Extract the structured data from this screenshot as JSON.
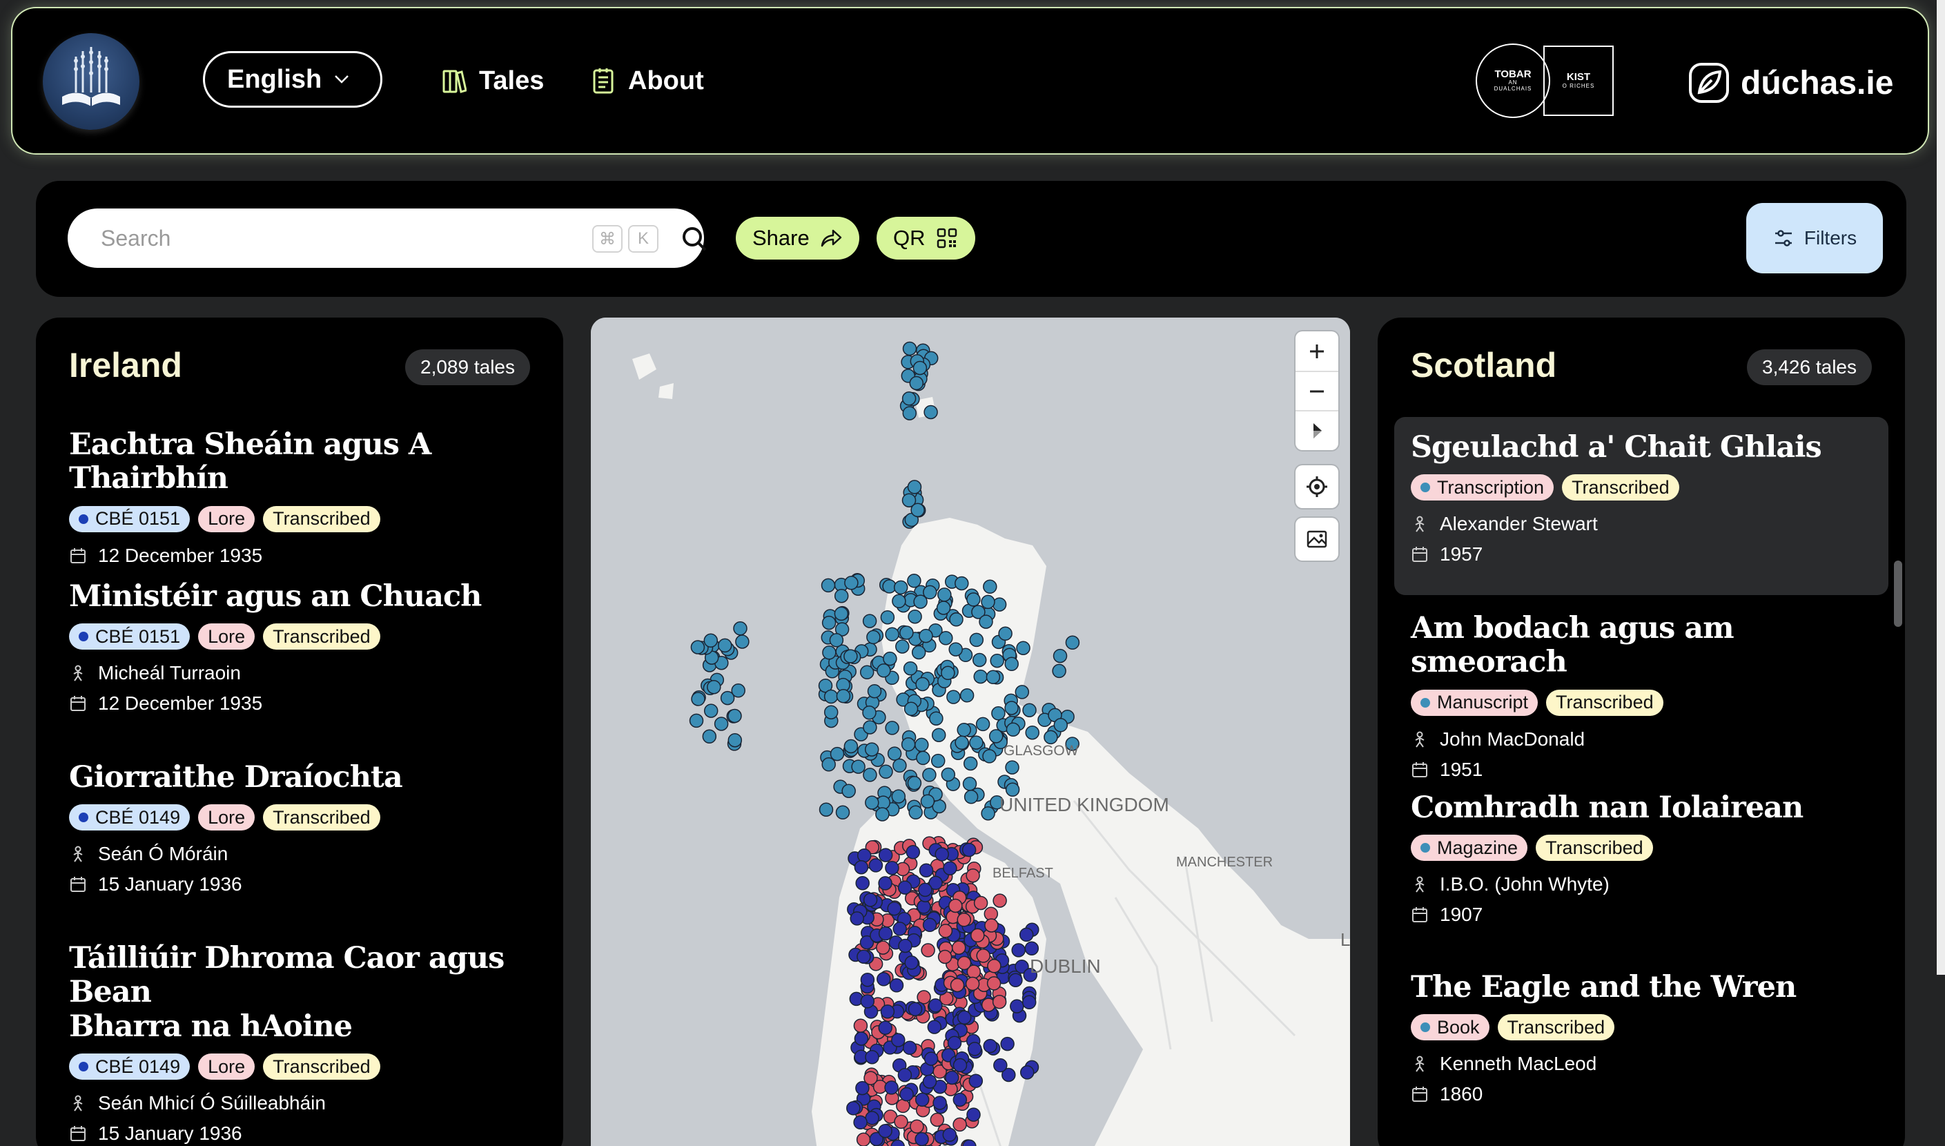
{
  "header": {
    "language": "English",
    "nav": {
      "tales": "Tales",
      "about": "About"
    },
    "partner1": {
      "line1": "TOBAR",
      "small": "AN",
      "line2": "DUALCHAIS"
    },
    "partner2": {
      "line1": "KIST",
      "line2": "O RICHES"
    },
    "site": "dúchas.ie"
  },
  "toolbar": {
    "search_placeholder": "Search",
    "kbd1": "⌘",
    "kbd2": "K",
    "share": "Share",
    "qr": "QR",
    "filters": "Filters"
  },
  "ireland": {
    "title": "Ireland",
    "count": "2,089 tales",
    "tales": [
      {
        "title": "Eachtra Sheáin agus A Thairbhín",
        "tags": [
          "CBÉ 0151",
          "Lore",
          "Transcribed"
        ],
        "date": "12 December 1935"
      },
      {
        "title": "Ministéir agus an Chuach",
        "tags": [
          "CBÉ 0151",
          "Lore",
          "Transcribed"
        ],
        "person": "Micheál Turraoin",
        "date": "12 December 1935"
      },
      {
        "title": "Giorraithe Draíochta",
        "tags": [
          "CBÉ 0149",
          "Lore",
          "Transcribed"
        ],
        "person": "Seán Ó Móráin",
        "date": "15 January 1936"
      },
      {
        "title_l1": "Táilliúir Dhroma Caor agus Bean",
        "title_l2": "Bharra na hAoine",
        "tags": [
          "CBÉ 0149",
          "Lore",
          "Transcribed"
        ],
        "person": "Seán Mhicí Ó Súilleabháin",
        "date": "15 January 1936"
      }
    ]
  },
  "scotland": {
    "title": "Scotland",
    "count": "3,426 tales",
    "tales": [
      {
        "title": "Sgeulachd a' Chait Ghlais",
        "tags": [
          "Transcription",
          "Transcribed"
        ],
        "person": "Alexander Stewart",
        "date": "1957"
      },
      {
        "title": "Am bodach agus am smeorach",
        "tags": [
          "Manuscript",
          "Transcribed"
        ],
        "person": "John MacDonald",
        "date": "1951"
      },
      {
        "title": "Comhradh nan Iolairean",
        "tags": [
          "Magazine",
          "Transcribed"
        ],
        "person": "I.B.O. (John Whyte)",
        "date": "1907"
      },
      {
        "title": "The Eagle and the Wren",
        "tags": [
          "Book",
          "Transcribed"
        ],
        "person": "Kenneth MacLeod",
        "date": "1860"
      }
    ]
  },
  "map": {
    "labels": {
      "glasgow": "GLASGOW",
      "uk": "UNITED KINGDOM",
      "belfast": "BELFAST",
      "manchester": "MANCHESTER",
      "dublin": "DUBLIN",
      "london": "L"
    },
    "colors": {
      "scotland": "#3b8db5",
      "ireland_blue": "#2b2fa6",
      "ireland_red": "#d85565"
    }
  }
}
